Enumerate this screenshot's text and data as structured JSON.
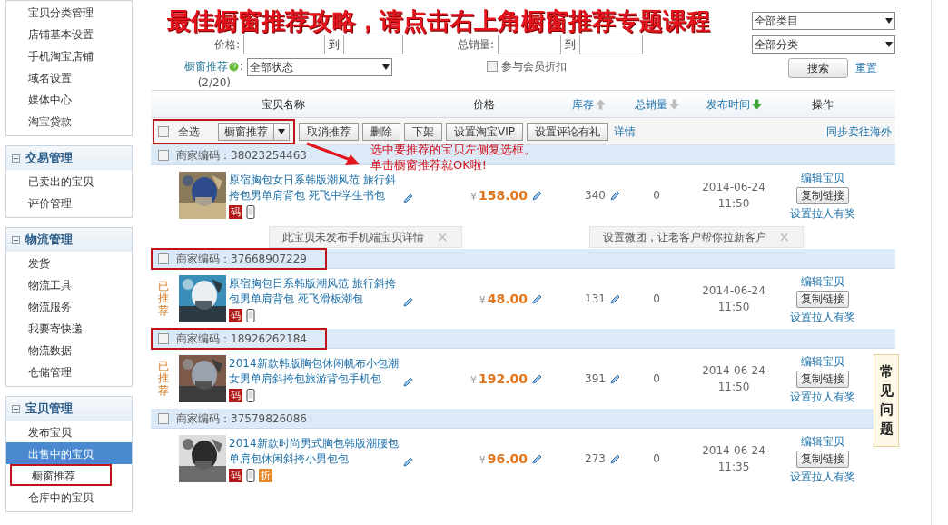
{
  "sidebar": {
    "groups": [
      {
        "items": [
          {
            "label": "宝贝分类管理",
            "selected": false,
            "highlighted": false
          },
          {
            "label": "店铺基本设置",
            "selected": false,
            "highlighted": false
          },
          {
            "label": "手机淘宝店铺",
            "selected": false,
            "highlighted": false
          },
          {
            "label": "域名设置",
            "selected": false,
            "highlighted": false
          },
          {
            "label": "媒体中心",
            "selected": false,
            "highlighted": false
          },
          {
            "label": "淘宝贷款",
            "selected": false,
            "highlighted": false
          }
        ]
      },
      {
        "title": "交易管理",
        "expanded": true,
        "items": [
          {
            "label": "已卖出的宝贝",
            "selected": false,
            "highlighted": false
          },
          {
            "label": "评价管理",
            "selected": false,
            "highlighted": false
          }
        ]
      },
      {
        "title": "物流管理",
        "expanded": true,
        "items": [
          {
            "label": "发货",
            "selected": false,
            "highlighted": false
          },
          {
            "label": "物流工具",
            "selected": false,
            "highlighted": false
          },
          {
            "label": "物流服务",
            "selected": false,
            "highlighted": false
          },
          {
            "label": "我要寄快递",
            "selected": false,
            "highlighted": false
          },
          {
            "label": "物流数据",
            "selected": false,
            "highlighted": false
          },
          {
            "label": "仓储管理",
            "selected": false,
            "highlighted": false
          }
        ]
      },
      {
        "title": "宝贝管理",
        "expanded": true,
        "items": [
          {
            "label": "发布宝贝",
            "selected": false,
            "highlighted": false
          },
          {
            "label": "出售中的宝贝",
            "selected": true,
            "highlighted": false
          },
          {
            "label": "橱窗推荐",
            "selected": false,
            "highlighted": true
          },
          {
            "label": "仓库中的宝贝",
            "selected": false,
            "highlighted": false
          }
        ]
      }
    ]
  },
  "banner": "最佳橱窗推荐攻略，请点击右上角橱窗推荐专题课程",
  "filters": {
    "price_label": "价格:",
    "to_1": "到",
    "sales_label": "总销量:",
    "to_2": "到",
    "category": "全部类目",
    "shop_category": "全部分类",
    "showcase_label": "橱窗推荐",
    "showcase_colon": ":",
    "showcase_count": "(2/20)",
    "showcase_status": "全部状态",
    "member_discount": {
      "label": "参与会员折扣",
      "checked": false
    },
    "search_button": "搜索",
    "reset_link": "重置"
  },
  "columns": [
    {
      "label": "宝贝名称"
    },
    {
      "label": "价格"
    },
    {
      "label": "库存",
      "arrow_up": true,
      "active": false
    },
    {
      "label": "总销量",
      "arrow_up": false,
      "active": false
    },
    {
      "label": "发布时间",
      "arrow_up": false,
      "active": true
    },
    {
      "label": "操作"
    }
  ],
  "toolbar": {
    "select_all": {
      "label": "全选",
      "checked": false,
      "highlighted": true
    },
    "buttons": [
      {
        "label": "橱窗推荐",
        "kind": "dropdown"
      },
      {
        "label": "取消推荐",
        "kind": "plain"
      },
      {
        "label": "删除",
        "kind": "plain"
      },
      {
        "label": "下架",
        "kind": "plain"
      },
      {
        "label": "设置淘宝VIP",
        "kind": "plain"
      },
      {
        "label": "设置评论有礼",
        "kind": "plain"
      }
    ],
    "details_link": "详情",
    "sync_link": "同步卖往海外"
  },
  "annotation": {
    "lines": [
      "选中要推荐的宝贝左侧复选框。",
      "单击橱窗推荐就OK啦!"
    ]
  },
  "products": [
    {
      "code_label": "商家编码：",
      "code": "38023254463",
      "checked": false,
      "highlighted": false,
      "title": "原宿胸包女日系韩版潮风范 旅行斜挎包男单肩背包 死飞中学生书包",
      "badges": [
        {
          "kind": "code",
          "text": "码"
        },
        {
          "kind": "mobile"
        }
      ],
      "price_symbol": "¥",
      "price": "158.00",
      "stock": "340",
      "sales": "0",
      "date": "2014-06-24",
      "time": "11:50",
      "actions": [
        "编辑宝贝",
        "复制链接",
        "设置拉人有奖"
      ],
      "tips": [
        {
          "text": "此宝贝未发布手机端宝贝详情",
          "close": "×"
        },
        {
          "text": "设置微团，让老客户帮你拉新客户",
          "close": "×"
        }
      ]
    },
    {
      "code_label": "商家编码：",
      "code": "37668907229",
      "checked": false,
      "highlighted": true,
      "status": "已推荐",
      "title": "原宿胸包日系韩版潮风范 旅行斜挎包男单肩背包 死飞滑板潮包",
      "badges": [
        {
          "kind": "code",
          "text": "码"
        },
        {
          "kind": "mobile"
        }
      ],
      "price_symbol": "¥",
      "price": "48.00",
      "stock": "131",
      "sales": "0",
      "date": "2014-06-24",
      "time": "11:50",
      "actions": [
        "编辑宝贝",
        "复制链接",
        "设置拉人有奖"
      ]
    },
    {
      "code_label": "商家编码：",
      "code": "18926262184",
      "checked": false,
      "highlighted": true,
      "status": "已推荐",
      "title": "2014新款韩版胸包休闲帆布小包潮女男单肩斜挎包旅游背包手机包",
      "badges": [
        {
          "kind": "code",
          "text": "码"
        },
        {
          "kind": "mobile"
        }
      ],
      "price_symbol": "¥",
      "price": "192.00",
      "stock": "391",
      "sales": "0",
      "date": "2014-06-24",
      "time": "11:50",
      "actions": [
        "编辑宝贝",
        "复制链接",
        "设置拉人有奖"
      ]
    },
    {
      "code_label": "商家编码：",
      "code": "37579826086",
      "checked": false,
      "highlighted": false,
      "title": "2014新款时尚男式胸包韩版潮腰包单肩包休闲斜挎小男包包",
      "badges": [
        {
          "kind": "code",
          "text": "码"
        },
        {
          "kind": "mobile"
        },
        {
          "kind": "discount",
          "text": "折"
        }
      ],
      "price_symbol": "¥",
      "price": "96.00",
      "stock": "273",
      "sales": "0",
      "date": "2014-06-24",
      "time": "11:35",
      "actions": [
        "编辑宝贝",
        "复制链接",
        "设置拉人有奖"
      ]
    }
  ],
  "faq_tab": "常见问题"
}
